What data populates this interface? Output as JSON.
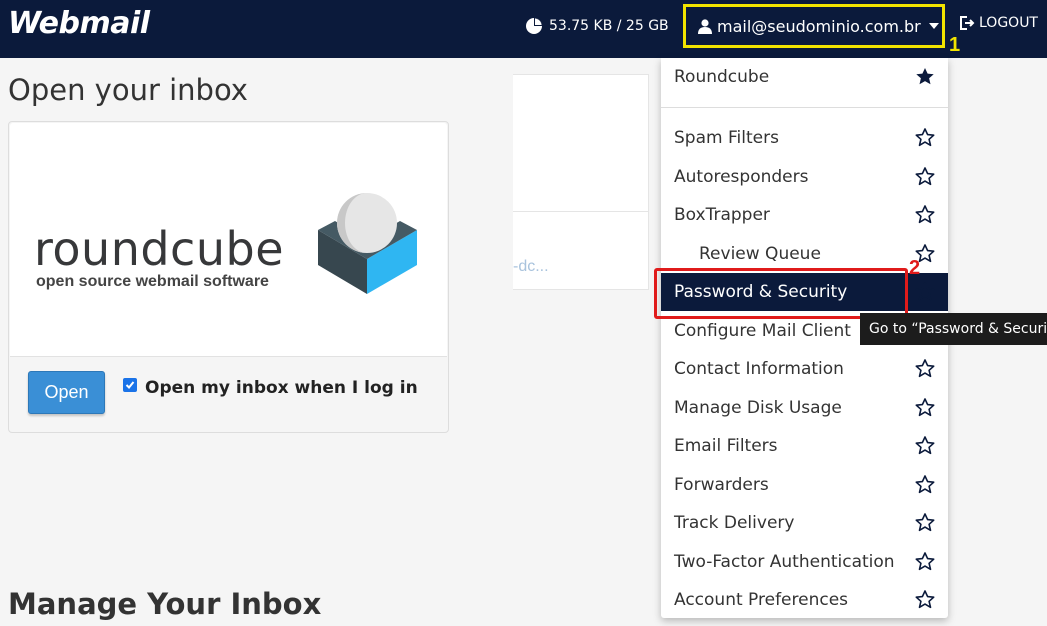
{
  "header": {
    "brand": "Webmail",
    "disk_usage": "53.75 KB / 25 GB",
    "user_email": "mail@seudominio.com.br",
    "logout_label": "LOGOUT",
    "annotation_1": "1"
  },
  "inbox": {
    "title": "Open your inbox",
    "app_name": "roundcube",
    "app_tagline": "open source webmail software",
    "open_button": "Open",
    "auto_open_label": "Open my inbox when I log in",
    "auto_open_checked": true
  },
  "manage": {
    "title": "Manage Your Inbox"
  },
  "middle_card": {
    "fragment_text": "-dc..."
  },
  "menu": {
    "top_item": {
      "label": "Roundcube",
      "starred": true
    },
    "items": [
      {
        "label": "Spam Filters",
        "starred": false
      },
      {
        "label": "Autoresponders",
        "starred": false
      },
      {
        "label": "BoxTrapper",
        "starred": false
      },
      {
        "label": "Review Queue",
        "starred": false
      },
      {
        "label": "Password & Security",
        "starred": false
      },
      {
        "label": "Configure Mail Client",
        "starred": false
      },
      {
        "label": "Contact Information",
        "starred": false
      },
      {
        "label": "Manage Disk Usage",
        "starred": false
      },
      {
        "label": "Email Filters",
        "starred": false
      },
      {
        "label": "Forwarders",
        "starred": false
      },
      {
        "label": "Track Delivery",
        "starred": false
      },
      {
        "label": "Two-Factor Authentication",
        "starred": false
      },
      {
        "label": "Account Preferences",
        "starred": false
      }
    ],
    "annotation_2": "2",
    "tooltip": "Go to “Password & Security”"
  },
  "colors": {
    "navbar": "#0b1a3b",
    "highlight_yellow": "#f2e400",
    "highlight_red": "#e01b1b",
    "primary_button": "#3a8fd6"
  }
}
